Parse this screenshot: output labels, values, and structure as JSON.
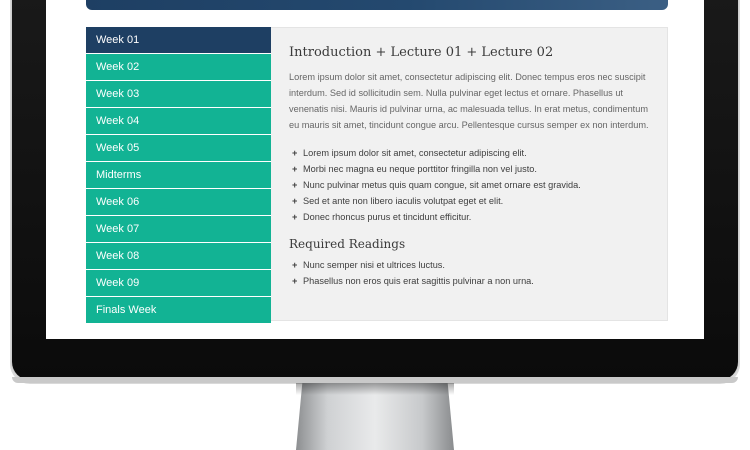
{
  "sidebar": {
    "items": [
      {
        "label": "Week 01",
        "active": true
      },
      {
        "label": "Week 02"
      },
      {
        "label": "Week 03"
      },
      {
        "label": "Week 04"
      },
      {
        "label": "Week 05"
      },
      {
        "label": "Midterms"
      },
      {
        "label": "Week 06"
      },
      {
        "label": "Week 07"
      },
      {
        "label": "Week 08"
      },
      {
        "label": "Week 09"
      },
      {
        "label": "Finals Week"
      }
    ]
  },
  "content": {
    "title": "Introduction + Lecture 01 + Lecture 02",
    "paragraph": "Lorem ipsum dolor sit amet, consectetur adipiscing elit. Donec tempus eros nec suscipit interdum. Sed id sollicitudin sem. Nulla pulvinar eget lectus et ornare. Phasellus ut venenatis nisi. Mauris id pulvinar urna, ac malesuada tellus. In erat metus, condimentum eu mauris sit amet, tincidunt congue arcu. Pellentesque cursus semper ex non interdum.",
    "bullet_char": "+",
    "bullets": [
      "Lorem ipsum dolor sit amet, consectetur adipiscing elit.",
      "Morbi nec magna eu neque porttitor fringilla non vel justo.",
      "Nunc pulvinar metus quis quam congue, sit amet ornare est gravida.",
      "Sed et ante non libero iaculis volutpat eget et elit.",
      "Donec rhoncus purus et tincidunt efficitur."
    ],
    "readings_title": "Required Readings",
    "readings": [
      "Nunc semper nisi et ultrices luctus.",
      "Phasellus non eros quis erat sagittis pulvinar a non urna."
    ]
  },
  "colors": {
    "accent_teal": "#12b394",
    "active_navy": "#1e3f63",
    "panel_bg": "#f1f1f1"
  }
}
